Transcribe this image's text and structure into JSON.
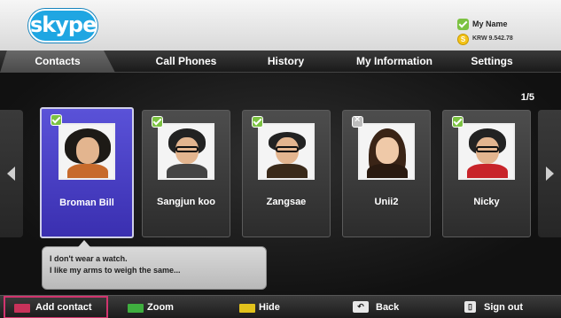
{
  "header": {
    "logo_text": "skype",
    "user_name": "My Name",
    "credit": "KRW 9.542.78",
    "credit_icon_glyph": "S"
  },
  "tabs": [
    {
      "label": "Contacts",
      "active": true
    },
    {
      "label": "Call Phones",
      "active": false
    },
    {
      "label": "History",
      "active": false
    },
    {
      "label": "My Information",
      "active": false
    },
    {
      "label": "Settings",
      "active": false
    }
  ],
  "page_indicator": "1/5",
  "contacts": [
    {
      "name": "Broman Bill",
      "status": "online",
      "selected": true
    },
    {
      "name": "Sangjun koo",
      "status": "online",
      "selected": false
    },
    {
      "name": "Zangsae",
      "status": "online",
      "selected": false
    },
    {
      "name": "Unii2",
      "status": "offline",
      "selected": false
    },
    {
      "name": "Nicky",
      "status": "online",
      "selected": false
    }
  ],
  "mood_message": {
    "line1": "I don't wear a watch.",
    "line2": "I like my arms to weigh the same..."
  },
  "bottom_bar": {
    "add_contact": {
      "label": "Add contact",
      "key_color": "#c8325a"
    },
    "zoom": {
      "label": "Zoom",
      "key_color": "#3fae3f"
    },
    "hide": {
      "label": "Hide",
      "key_color": "#e2c21c"
    },
    "back": {
      "label": "Back",
      "icon": "back-key-icon"
    },
    "sign_out": {
      "label": "Sign out",
      "icon": "exit-key-icon"
    }
  },
  "colors": {
    "accent_blue": "#1fa6e2",
    "selected_card": "#4a41c8",
    "online_green": "#7cc242"
  }
}
